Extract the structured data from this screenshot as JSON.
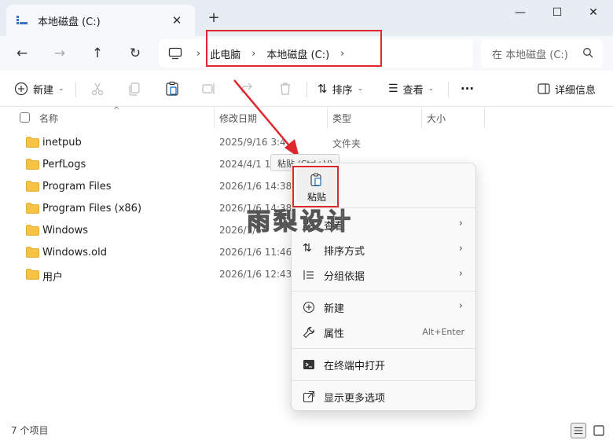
{
  "window": {
    "tab_title": "本地磁盘 (C:)",
    "tab_close": "✕",
    "new_tab": "+",
    "minimize": "—",
    "maximize": "☐",
    "close": "✕"
  },
  "nav": {
    "back": "←",
    "forward": "→",
    "up": "↑",
    "refresh": "↻",
    "breadcrumbs": [
      "此电脑",
      "本地磁盘 (C:)"
    ],
    "separator": "›",
    "search_placeholder": "在 本地磁盘 (C:)"
  },
  "toolbar": {
    "new_label": "新建",
    "sort_label": "排序",
    "view_label": "查看",
    "more": "···",
    "details_label": "详细信息"
  },
  "columns": {
    "name": "名称",
    "date": "修改日期",
    "type": "类型",
    "size": "大小",
    "sort_arrow": "^"
  },
  "files": [
    {
      "name": "inetpub",
      "date": "2025/9/16 3:4",
      "type": "文件夹"
    },
    {
      "name": "PerfLogs",
      "date": "2024/4/1 15:2",
      "type": ""
    },
    {
      "name": "Program Files",
      "date": "2026/1/6 14:38",
      "type": ""
    },
    {
      "name": "Program Files (x86)",
      "date": "2026/1/6 14:38",
      "type": ""
    },
    {
      "name": "Windows",
      "date": "2026/1/6",
      "type": ""
    },
    {
      "name": "Windows.old",
      "date": "2026/1/6 11:46",
      "type": ""
    },
    {
      "name": "用户",
      "date": "2026/1/6 12:43",
      "type": ""
    }
  ],
  "tooltip": "粘贴 (Ctrl+V)",
  "context_menu": {
    "paste_label": "粘贴",
    "items": [
      {
        "label": "查看",
        "chevron": "›"
      },
      {
        "label": "排序方式",
        "chevron": "›"
      },
      {
        "label": "分组依据",
        "chevron": "›"
      },
      {
        "label": "新建",
        "chevron": "›"
      },
      {
        "label": "属性",
        "shortcut": "Alt+Enter"
      },
      {
        "label": "在终端中打开"
      },
      {
        "label": "显示更多选项"
      }
    ]
  },
  "watermark": "雨梨设计",
  "status": {
    "item_count": "7 个项目"
  },
  "colors": {
    "accent": "#0067c0",
    "highlight": "#e0262d",
    "folder": "#f6c343"
  }
}
